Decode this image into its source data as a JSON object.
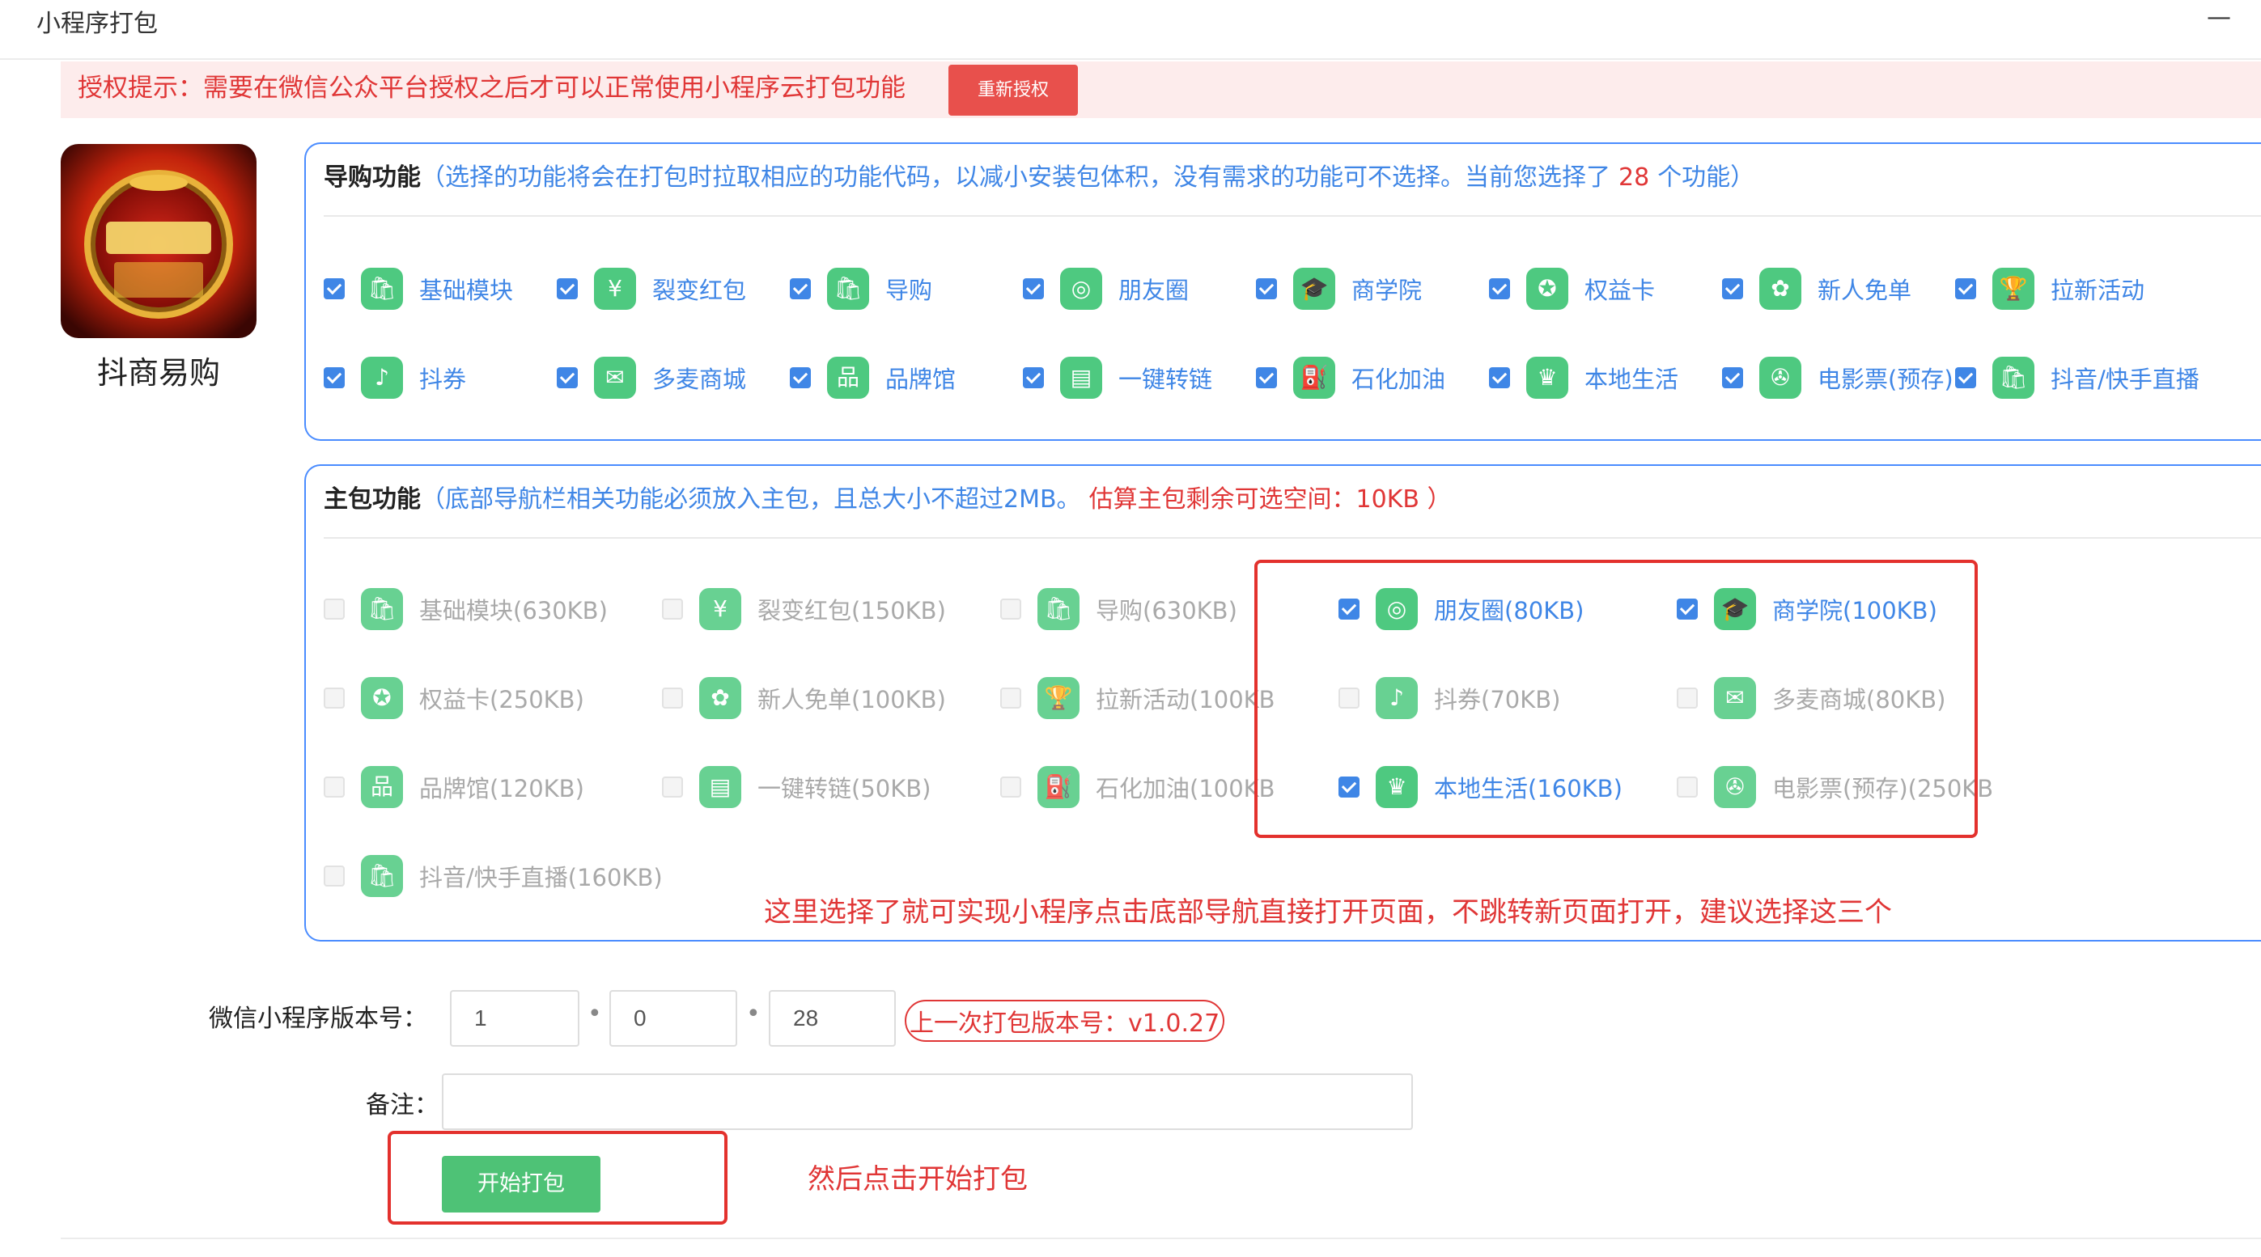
{
  "header": {
    "title": "小程序打包",
    "minimize": "—"
  },
  "notice": {
    "text": "授权提示：需要在微信公众平台授权之后才可以正常使用小程序云打包功能",
    "reauth_label": "重新授权"
  },
  "app": {
    "name": "抖商易购",
    "logo_icon": "app-logo-icon"
  },
  "guide": {
    "title": "导购功能",
    "desc_prefix": "（选择的功能将会在打包时拉取相应的功能代码，以减小安装包体积，没有需求的功能可不选择。当前您选择了",
    "count": "28",
    "desc_suffix": "个功能）",
    "items": [
      {
        "label": "基础模块",
        "icon": "shop-bag-icon",
        "glyph": "🛍",
        "checked": true
      },
      {
        "label": "裂变红包",
        "icon": "red-packet-icon",
        "glyph": "¥",
        "checked": true
      },
      {
        "label": "导购",
        "icon": "shop-bag-icon",
        "glyph": "🛍",
        "checked": true
      },
      {
        "label": "朋友圈",
        "icon": "camera-aperture-icon",
        "glyph": "◎",
        "checked": true
      },
      {
        "label": "商学院",
        "icon": "graduation-cap-icon",
        "glyph": "🎓",
        "checked": true
      },
      {
        "label": "权益卡",
        "icon": "badge-icon",
        "glyph": "✪",
        "checked": true
      },
      {
        "label": "新人免单",
        "icon": "gift-icon",
        "glyph": "✿",
        "checked": true
      },
      {
        "label": "拉新活动",
        "icon": "trophy-icon",
        "glyph": "🏆",
        "checked": true
      },
      {
        "label": "抖券",
        "icon": "tiktok-icon",
        "glyph": "♪",
        "checked": true
      },
      {
        "label": "多麦商城",
        "icon": "mail-icon",
        "glyph": "✉",
        "checked": true
      },
      {
        "label": "品牌馆",
        "icon": "brand-icon",
        "glyph": "品",
        "checked": true
      },
      {
        "label": "一键转链",
        "icon": "document-icon",
        "glyph": "▤",
        "checked": true
      },
      {
        "label": "石化加油",
        "icon": "fuel-icon",
        "glyph": "⛽",
        "checked": true
      },
      {
        "label": "本地生活",
        "icon": "crown-icon",
        "glyph": "♛",
        "checked": true
      },
      {
        "label": "电影票(预存)",
        "icon": "film-reel-icon",
        "glyph": "✇",
        "checked": true
      },
      {
        "label": "抖音/快手直播",
        "icon": "shop-bag-icon",
        "glyph": "🛍",
        "checked": true
      }
    ]
  },
  "main_pkg": {
    "title": "主包功能",
    "desc": "（底部导航栏相关功能必须放入主包，且总大小不超过2MB。",
    "estimate": "估算主包剩余可选空间：10KB ）",
    "items": [
      {
        "label": "基础模块(630KB)",
        "icon": "shop-bag-icon",
        "glyph": "🛍",
        "checked": false,
        "enabled": false
      },
      {
        "label": "裂变红包(150KB)",
        "icon": "red-packet-icon",
        "glyph": "¥",
        "checked": false,
        "enabled": false
      },
      {
        "label": "导购(630KB)",
        "icon": "shop-bag-icon",
        "glyph": "🛍",
        "checked": false,
        "enabled": false
      },
      {
        "label": "朋友圈(80KB)",
        "icon": "camera-aperture-icon",
        "glyph": "◎",
        "checked": true,
        "enabled": true
      },
      {
        "label": "商学院(100KB)",
        "icon": "graduation-cap-icon",
        "glyph": "🎓",
        "checked": true,
        "enabled": true
      },
      {
        "label": "权益卡(250KB)",
        "icon": "badge-icon",
        "glyph": "✪",
        "checked": false,
        "enabled": false
      },
      {
        "label": "新人免单(100KB)",
        "icon": "gift-icon",
        "glyph": "✿",
        "checked": false,
        "enabled": false
      },
      {
        "label": "拉新活动(100KB",
        "icon": "trophy-icon",
        "glyph": "🏆",
        "checked": false,
        "enabled": false
      },
      {
        "label": "抖券(70KB)",
        "icon": "tiktok-icon",
        "glyph": "♪",
        "checked": false,
        "enabled": false
      },
      {
        "label": "多麦商城(80KB)",
        "icon": "mail-icon",
        "glyph": "✉",
        "checked": false,
        "enabled": false
      },
      {
        "label": "品牌馆(120KB)",
        "icon": "brand-icon",
        "glyph": "品",
        "checked": false,
        "enabled": false
      },
      {
        "label": "一键转链(50KB)",
        "icon": "document-icon",
        "glyph": "▤",
        "checked": false,
        "enabled": false
      },
      {
        "label": "石化加油(100KB",
        "icon": "fuel-icon",
        "glyph": "⛽",
        "checked": false,
        "enabled": false
      },
      {
        "label": "本地生活(160KB)",
        "icon": "crown-icon",
        "glyph": "♛",
        "checked": true,
        "enabled": true
      },
      {
        "label": "电影票(预存)(250KB",
        "icon": "film-reel-icon",
        "glyph": "✇",
        "checked": false,
        "enabled": false
      },
      {
        "label": "抖音/快手直播(160KB)",
        "icon": "shop-bag-icon",
        "glyph": "🛍",
        "checked": false,
        "enabled": false
      }
    ]
  },
  "annotation": {
    "main_hint": "这里选择了就可实现小程序点击底部导航直接打开页面，不跳转新页面打开，建议选择这三个",
    "start_hint": "然后点击开始打包"
  },
  "version": {
    "label": "微信小程序版本号：",
    "major": "1",
    "minor": "0",
    "patch": "28",
    "sep": "•",
    "last": "上一次打包版本号：v1.0.27"
  },
  "remark": {
    "label": "备注：",
    "value": "",
    "placeholder": ""
  },
  "start_label": "开始打包",
  "colors": {
    "accent": "#3f86e6",
    "danger": "#e03636",
    "green": "#4ec980",
    "notice_bg": "#fdecec"
  }
}
